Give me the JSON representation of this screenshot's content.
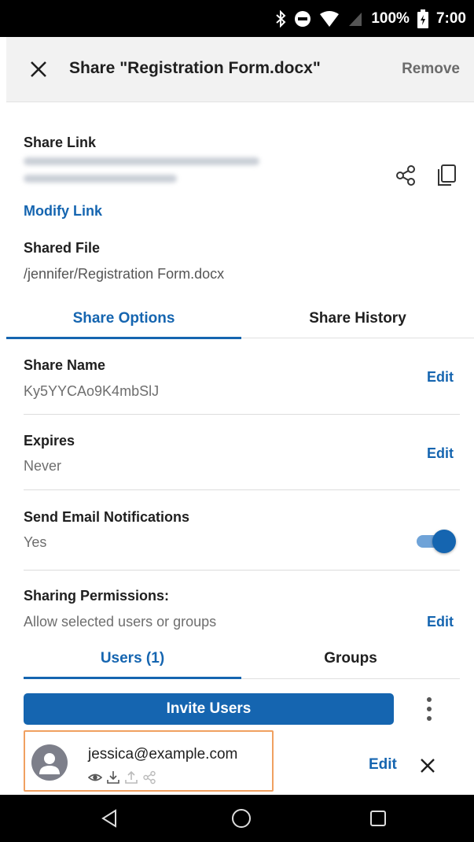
{
  "status_bar": {
    "battery": "100%",
    "time": "7:00"
  },
  "header": {
    "title": "Share \"Registration Form.docx\"",
    "remove_label": "Remove"
  },
  "share_link": {
    "label": "Share Link",
    "modify_label": "Modify Link"
  },
  "shared_file": {
    "label": "Shared File",
    "path": "/jennifer/Registration Form.docx"
  },
  "tabs": [
    {
      "label": "Share Options",
      "active": true
    },
    {
      "label": "Share History",
      "active": false
    }
  ],
  "options": {
    "share_name": {
      "label": "Share Name",
      "value": "Ky5YYCAo9K4mbSlJ",
      "action": "Edit"
    },
    "expires": {
      "label": "Expires",
      "value": "Never",
      "action": "Edit"
    },
    "email_notifications": {
      "label": "Send Email Notifications",
      "value": "Yes",
      "enabled": true
    },
    "permissions": {
      "label": "Sharing Permissions:",
      "value": "Allow selected users or groups",
      "action": "Edit"
    }
  },
  "sub_tabs": [
    {
      "label": "Users (1)",
      "active": true
    },
    {
      "label": "Groups",
      "active": false
    }
  ],
  "invite_button": "Invite Users",
  "users": [
    {
      "email": "jessica@example.com",
      "edit_label": "Edit",
      "permissions": [
        "eye-icon",
        "download-icon",
        "upload-icon",
        "share-icon"
      ]
    }
  ],
  "colors": {
    "accent": "#1565b0",
    "header_bg": "#f2f2f2",
    "highlight_border": "#f0a060",
    "muted_text": "#6e6e6e"
  }
}
